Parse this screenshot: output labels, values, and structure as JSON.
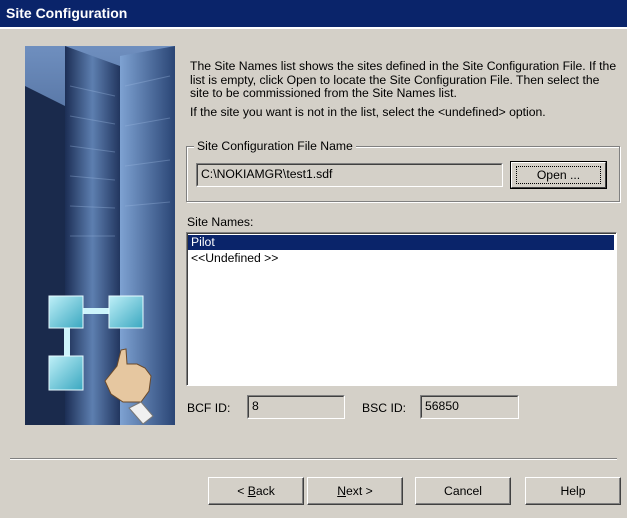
{
  "window": {
    "title": "Site Configuration"
  },
  "description": {
    "para1": "The Site Names list shows the sites defined in the Site Configuration File. If the list is empty, click Open to locate the Site Configuration File. Then select the site to be commissioned from the Site Names list.",
    "para2": "If the site you want is not in the list, select the <undefined> option."
  },
  "file_group": {
    "label": "Site Configuration File Name",
    "path_value": "C:\\NOKIAMGR\\test1.sdf",
    "open_button": "Open ..."
  },
  "site_names": {
    "label": "Site Names:",
    "items": [
      {
        "label": "Pilot",
        "selected": true
      },
      {
        "label": "<<Undefined >>",
        "selected": false
      }
    ]
  },
  "ids": {
    "bcf_label": "BCF ID:",
    "bcf_value": "8",
    "bsc_label": "BSC ID:",
    "bsc_value": "56850"
  },
  "buttons": {
    "back_prefix": "< ",
    "back_mnemonic": "B",
    "back_rest": "ack",
    "next_mnemonic": "N",
    "next_rest": "ext >",
    "cancel": "Cancel",
    "help": "Help"
  },
  "colors": {
    "titlebar": "#0a246a",
    "selection": "#0a246a",
    "face": "#d4d0c8"
  }
}
